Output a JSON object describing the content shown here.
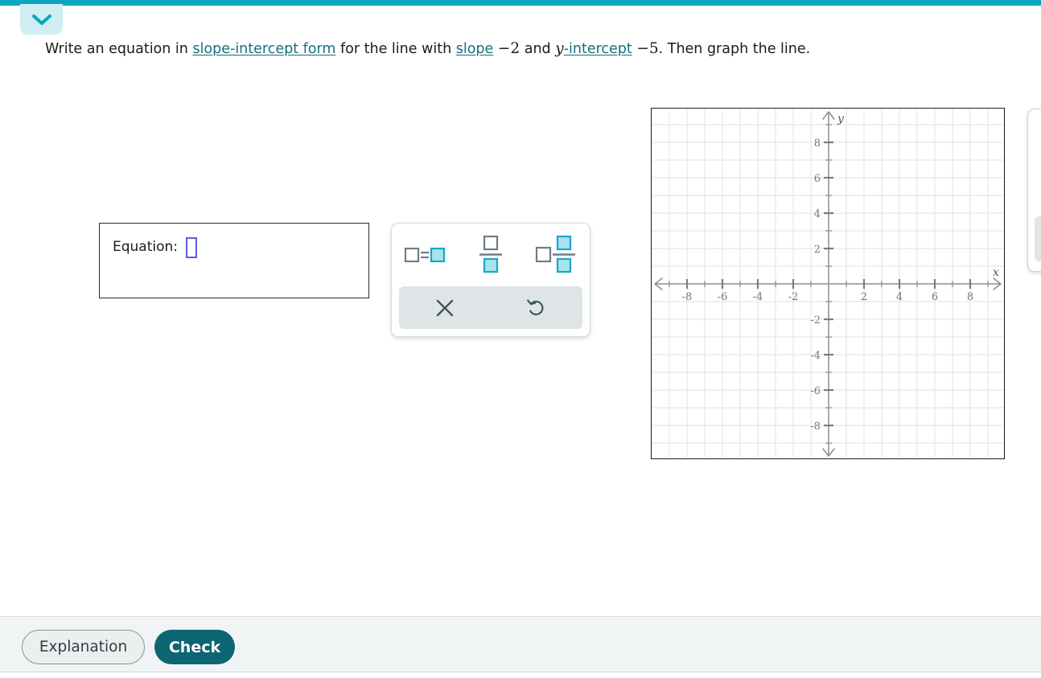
{
  "topbar": {
    "color": "#0aa6bd",
    "collapse_tab": {
      "icon": "chevron-down-icon",
      "background": "#cfeef2",
      "icon_color": "#0aa6bd"
    }
  },
  "question": {
    "part1": "Write an equation in ",
    "link1": "slope-intercept form",
    "part2": " for the line with ",
    "link2": "slope",
    "slope_value": "−2",
    "part3": " and ",
    "y_var": "y",
    "link3": "-intercept",
    "intercept_value": "−5",
    "part4": ". Then graph the line."
  },
  "answer": {
    "label": "Equation:",
    "value": "",
    "placeholder_box_color": "#5c5ce0"
  },
  "palette": {
    "templates": [
      {
        "name": "equation-template",
        "label": "□=□"
      },
      {
        "name": "fraction-template",
        "label": "□/□"
      },
      {
        "name": "mixed-number-template",
        "label": "□ □/□"
      }
    ],
    "actions": [
      {
        "name": "clear-button",
        "icon": "close-x-icon",
        "label": "✕"
      },
      {
        "name": "undo-button",
        "icon": "undo-arrow-icon",
        "label": "↺"
      }
    ],
    "outline_color": "#6f7d85",
    "fill_color": "#a7e3ef",
    "accent_color": "#18a8c4",
    "action_bg": "#dfe5e7",
    "action_icon_color": "#3d5560"
  },
  "graph": {
    "x_label": "x",
    "y_label": "y",
    "x_ticks": [
      -8,
      -6,
      -4,
      -2,
      2,
      4,
      6,
      8
    ],
    "y_ticks": [
      8,
      6,
      4,
      2,
      -2,
      -4,
      -6,
      -8
    ],
    "x_range": [
      -10,
      10
    ],
    "y_range": [
      -10,
      10
    ],
    "grid": true,
    "grid_color": "#dddddd",
    "axis_color": "#808080",
    "label_color": "#707070",
    "border_color": "#1c1c1c",
    "plotted_series": []
  },
  "footer": {
    "explanation_label": "Explanation",
    "check_label": "Check",
    "check_color": "#0d6472",
    "background": "#f1f4f5"
  }
}
